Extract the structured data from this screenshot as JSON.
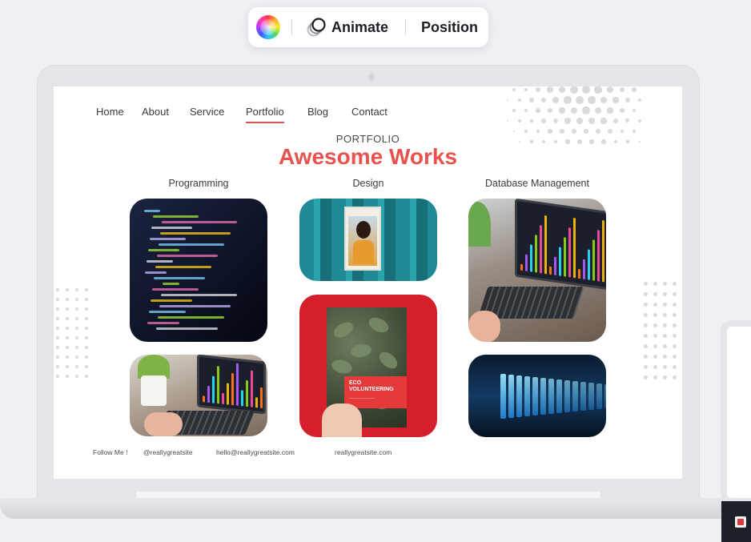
{
  "toolbar": {
    "animate_label": "Animate",
    "position_label": "Position"
  },
  "site": {
    "nav": [
      "Home",
      "About",
      "Service",
      "Portfolio",
      "Blog",
      "Contact"
    ],
    "active_nav": "Portfolio",
    "eyebrow": "PORTFOLIO",
    "headline": "Awesome Works",
    "columns": [
      "Programming",
      "Design",
      "Database Management"
    ],
    "eco_title": "ECO VOLUNTEERING",
    "footer": {
      "follow": "Follow Me !",
      "handle": "@reallygreatsite",
      "email": "hello@reallygreatsite.com",
      "website": "reallygreatsite.com"
    }
  },
  "colors": {
    "accent": "#e8524f",
    "background": "#eef0f4"
  },
  "icons": [
    "color-wheel-icon",
    "animate-icon",
    "calendar-icon"
  ]
}
